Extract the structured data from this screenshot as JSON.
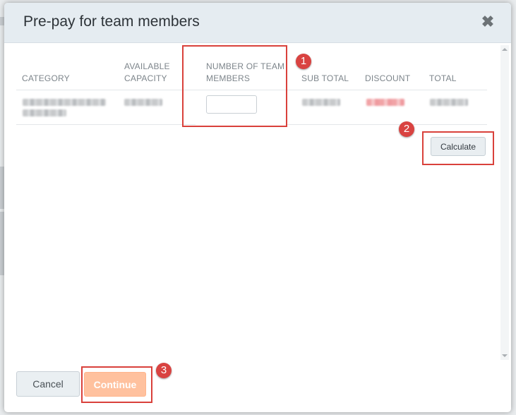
{
  "modal": {
    "title": "Pre-pay for team members",
    "close_icon": "close-icon",
    "close_glyph": "✖"
  },
  "table": {
    "columns": [
      {
        "label": "CATEGORY"
      },
      {
        "label": "AVAILABLE CAPACITY"
      },
      {
        "label": "NUMBER OF TEAM MEMBERS"
      },
      {
        "label": "SUB TOTAL"
      },
      {
        "label": "DISCOUNT"
      },
      {
        "label": "TOTAL"
      }
    ],
    "row": {
      "category": "",
      "available_capacity": "",
      "team_members_value": "",
      "sub_total": "",
      "discount": "",
      "total": ""
    }
  },
  "buttons": {
    "calculate": "Calculate",
    "cancel": "Cancel",
    "continue": "Continue"
  },
  "annotations": [
    "1",
    "2",
    "3"
  ],
  "colors": {
    "annotation": "#d9413b",
    "continue_button": "#ffc19e",
    "header_background": "#e5ecf1"
  }
}
